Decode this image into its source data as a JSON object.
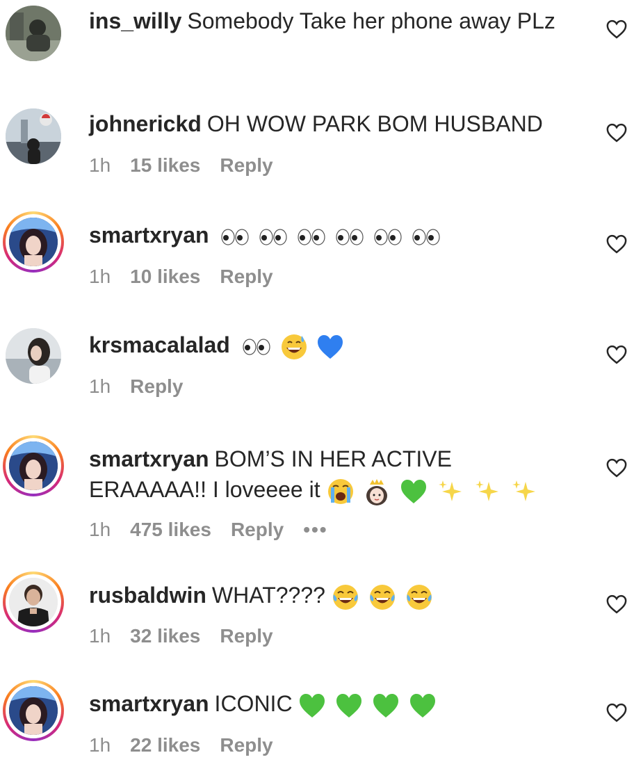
{
  "comments": [
    {
      "username": "ins_willy",
      "text": "Somebody Take her phone away PLz",
      "time": "",
      "likes": "",
      "reply": ""
    },
    {
      "username": "johnerickd",
      "text": "OH WOW PARK BOM HUSBAND",
      "time": "1h",
      "likes": "15 likes",
      "reply": "Reply"
    },
    {
      "username": "smartxryan",
      "text": "",
      "emojis": [
        "eyes",
        "eyes",
        "eyes",
        "eyes",
        "eyes",
        "eyes"
      ],
      "time": "1h",
      "likes": "10 likes",
      "reply": "Reply"
    },
    {
      "username": "krsmacalalad",
      "text": "",
      "emojis": [
        "eyes",
        "grinning-sweat",
        "blue-heart"
      ],
      "time": "1h",
      "likes": "",
      "reply": "Reply"
    },
    {
      "username": "smartxryan",
      "text": "BOM’S IN HER ACTIVE ERAAAAA!! I loveeee it",
      "emojis": [
        "loudly-crying",
        "princess",
        "green-heart",
        "sparkles",
        "sparkles",
        "sparkles"
      ],
      "time": "1h",
      "likes": "475 likes",
      "reply": "Reply",
      "more": "•••"
    },
    {
      "username": "rusbaldwin",
      "text": "WHAT????",
      "emojis": [
        "tears-of-joy",
        "tears-of-joy",
        "tears-of-joy"
      ],
      "time": "1h",
      "likes": "32 likes",
      "reply": "Reply"
    },
    {
      "username": "smartxryan",
      "text": "ICONIC",
      "emojis": [
        "green-heart",
        "green-heart",
        "green-heart",
        "green-heart"
      ],
      "time": "1h",
      "likes": "22 likes",
      "reply": "Reply"
    }
  ],
  "colors": {
    "text": "#262626",
    "meta": "#8e8e8e",
    "green_heart": "#4cc13f",
    "blue_heart": "#2f7ff0",
    "emoji_yellow": "#f8c93b"
  }
}
